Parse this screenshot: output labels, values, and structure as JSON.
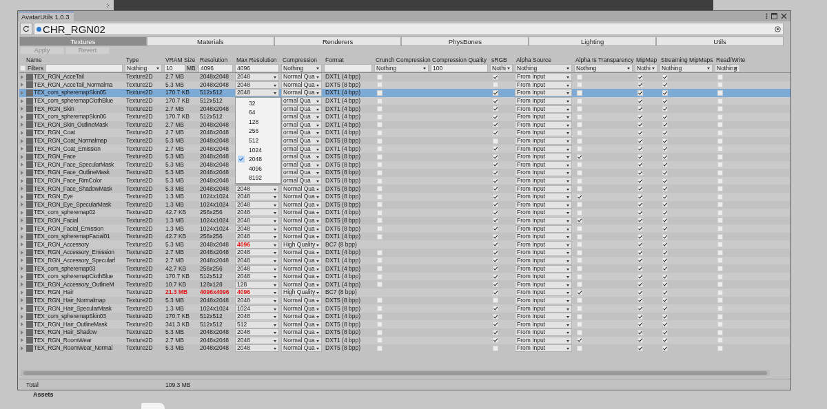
{
  "window": {
    "title": "AvatarUtils 1.0.3"
  },
  "object_field": {
    "value": "CHR_RGN02"
  },
  "tabs": [
    {
      "label": "Textures",
      "selected": true
    },
    {
      "label": "Materials",
      "selected": false
    },
    {
      "label": "Renderers",
      "selected": false
    },
    {
      "label": "PhysBones",
      "selected": false
    },
    {
      "label": "Lighting",
      "selected": false
    },
    {
      "label": "Utils",
      "selected": false
    }
  ],
  "actions": [
    {
      "label": "Apply",
      "disabled": true
    },
    {
      "label": "Revert",
      "disabled": true
    }
  ],
  "table": {
    "columns": [
      "Name",
      "Type",
      "VRAM Size",
      "Resolution",
      "Max Resolution",
      "Compression",
      "Format",
      "Crunch Compression",
      "Compression Quality",
      "sRGB",
      "Alpha Source",
      "Alpha Is Transparency",
      "MipMap",
      "Streaming MipMaps",
      "Read/Write"
    ],
    "filters": {
      "checked": false,
      "label": "Filters",
      "type": "Nothing",
      "vram": "10",
      "vram_unit": "MB",
      "resolution": "4096",
      "max_resolution": "4096",
      "compression": "Nothing",
      "crunch": "Nothing",
      "compression_quality": "100",
      "srgb": "Nothi",
      "alpha_source": "Nothing",
      "alpha_is_transparency": "Nothing",
      "mipmap": "Nothi",
      "streaming_mipmaps": "Nothing",
      "read_write": "Nothing"
    },
    "rows": [
      {
        "name": "TEX_RGN_AcceTail",
        "type": "Texture2D",
        "vram": "2.7 MB",
        "vram_warn": false,
        "resolution": "2048x2048",
        "resolution_warn": false,
        "max_resolution": "2048",
        "max_warn": false,
        "compression": "Normal Qua",
        "format": "DXT1 (4 bpp)",
        "crunch": false,
        "srgb": true,
        "alpha_source": "From Input",
        "alpha_is_transparency": false,
        "mipmap": true,
        "streaming_mipmaps": true,
        "read_write": false,
        "selected": false
      },
      {
        "name": "TEX_RGN_AcceTail_Normalma",
        "type": "Texture2D",
        "vram": "5.3 MB",
        "vram_warn": false,
        "resolution": "2048x2048",
        "resolution_warn": false,
        "max_resolution": "2048",
        "max_warn": false,
        "compression": "Normal Qua",
        "format": "DXT5 (8 bpp)",
        "crunch": false,
        "srgb": false,
        "alpha_source": "From Input",
        "alpha_is_transparency": false,
        "mipmap": true,
        "streaming_mipmaps": true,
        "read_write": false,
        "selected": false
      },
      {
        "name": "TEX_com_spheremapSkin05",
        "type": "Texture2D",
        "vram": "170.7 KB",
        "vram_warn": false,
        "resolution": "512x512",
        "resolution_warn": false,
        "max_resolution": "2048",
        "max_warn": false,
        "compression": "Normal Qua",
        "format": "DXT1 (4 bpp)",
        "crunch": false,
        "srgb": true,
        "alpha_source": "From Input",
        "alpha_is_transparency": false,
        "mipmap": true,
        "streaming_mipmaps": true,
        "read_write": false,
        "selected": true
      },
      {
        "name": "TEX_com_spheremapClothBlue",
        "type": "Texture2D",
        "vram": "170.7 KB",
        "vram_warn": false,
        "resolution": "512x512",
        "resolution_warn": false,
        "compression": "ormal Qua",
        "format": "DXT1 (4 bpp)",
        "crunch": false,
        "srgb": true,
        "alpha_source": "From Input",
        "alpha_is_transparency": false,
        "mipmap": true,
        "streaming_mipmaps": true,
        "read_write": false,
        "selected": false
      },
      {
        "name": "TEX_RGN_Skin",
        "type": "Texture2D",
        "vram": "2.7 MB",
        "vram_warn": false,
        "resolution": "2048x2048",
        "resolution_warn": false,
        "compression": "ormal Qua",
        "format": "DXT1 (4 bpp)",
        "crunch": false,
        "srgb": true,
        "alpha_source": "From Input",
        "alpha_is_transparency": false,
        "mipmap": true,
        "streaming_mipmaps": true,
        "read_write": false,
        "selected": false
      },
      {
        "name": "TEX_com_spheremapSkin06",
        "type": "Texture2D",
        "vram": "170.7 KB",
        "vram_warn": false,
        "resolution": "512x512",
        "resolution_warn": false,
        "compression": "ormal Qua",
        "format": "DXT1 (4 bpp)",
        "crunch": false,
        "srgb": true,
        "alpha_source": "From Input",
        "alpha_is_transparency": false,
        "mipmap": true,
        "streaming_mipmaps": true,
        "read_write": false,
        "selected": false
      },
      {
        "name": "TEX_RGN_Skin_OutlineMask",
        "type": "Texture2D",
        "vram": "2.7 MB",
        "vram_warn": false,
        "resolution": "2048x2048",
        "resolution_warn": false,
        "compression": "ormal Qua",
        "format": "DXT1 (4 bpp)",
        "crunch": false,
        "srgb": true,
        "alpha_source": "From Input",
        "alpha_is_transparency": false,
        "mipmap": true,
        "streaming_mipmaps": true,
        "read_write": false,
        "selected": false
      },
      {
        "name": "TEX_RGN_Coat",
        "type": "Texture2D",
        "vram": "2.7 MB",
        "vram_warn": false,
        "resolution": "2048x2048",
        "resolution_warn": false,
        "compression": "ormal Qua",
        "format": "DXT1 (4 bpp)",
        "crunch": false,
        "srgb": true,
        "alpha_source": "From Input",
        "alpha_is_transparency": false,
        "mipmap": true,
        "streaming_mipmaps": true,
        "read_write": false,
        "selected": false
      },
      {
        "name": "TEX_RGN_Coat_Normalmap",
        "type": "Texture2D",
        "vram": "5.3 MB",
        "vram_warn": false,
        "resolution": "2048x2048",
        "resolution_warn": false,
        "compression": "ormal Qua",
        "format": "DXT5 (8 bpp)",
        "crunch": false,
        "srgb": false,
        "alpha_source": "From Input",
        "alpha_is_transparency": false,
        "mipmap": true,
        "streaming_mipmaps": true,
        "read_write": false,
        "selected": false
      },
      {
        "name": "TEX_RGN_Coat_Emission",
        "type": "Texture2D",
        "vram": "2.7 MB",
        "vram_warn": false,
        "resolution": "2048x2048",
        "resolution_warn": false,
        "compression": "ormal Qua",
        "format": "DXT1 (4 bpp)",
        "crunch": false,
        "srgb": true,
        "alpha_source": "From Input",
        "alpha_is_transparency": false,
        "mipmap": true,
        "streaming_mipmaps": true,
        "read_write": false,
        "selected": false
      },
      {
        "name": "TEX_RGN_Face",
        "type": "Texture2D",
        "vram": "5.3 MB",
        "vram_warn": false,
        "resolution": "2048x2048",
        "resolution_warn": false,
        "compression": "ormal Qua",
        "format": "DXT5 (8 bpp)",
        "crunch": false,
        "srgb": true,
        "alpha_source": "From Input",
        "alpha_is_transparency": true,
        "mipmap": true,
        "streaming_mipmaps": true,
        "read_write": false,
        "selected": false
      },
      {
        "name": "TEX_RGN_Face_SpecularMask",
        "type": "Texture2D",
        "vram": "5.3 MB",
        "vram_warn": false,
        "resolution": "2048x2048",
        "resolution_warn": false,
        "compression": "ormal Qua",
        "format": "DXT5 (8 bpp)",
        "crunch": false,
        "srgb": true,
        "alpha_source": "From Input",
        "alpha_is_transparency": false,
        "mipmap": true,
        "streaming_mipmaps": true,
        "read_write": false,
        "selected": false
      },
      {
        "name": "TEX_RGN_Face_OutlineMask",
        "type": "Texture2D",
        "vram": "5.3 MB",
        "vram_warn": false,
        "resolution": "2048x2048",
        "resolution_warn": false,
        "compression": "ormal Qua",
        "format": "DXT5 (8 bpp)",
        "crunch": false,
        "srgb": true,
        "alpha_source": "From Input",
        "alpha_is_transparency": false,
        "mipmap": true,
        "streaming_mipmaps": true,
        "read_write": false,
        "selected": false
      },
      {
        "name": "TEX_RGN_Face_RimColor",
        "type": "Texture2D",
        "vram": "5.3 MB",
        "vram_warn": false,
        "resolution": "2048x2048",
        "resolution_warn": false,
        "compression": "ormal Qua",
        "format": "DXT5 (8 bpp)",
        "crunch": false,
        "srgb": true,
        "alpha_source": "From Input",
        "alpha_is_transparency": false,
        "mipmap": true,
        "streaming_mipmaps": true,
        "read_write": false,
        "selected": false
      },
      {
        "name": "TEX_RGN_Face_ShadowMask",
        "type": "Texture2D",
        "vram": "5.3 MB",
        "vram_warn": false,
        "resolution": "2048x2048",
        "resolution_warn": false,
        "max_resolution": "2048",
        "max_warn": false,
        "compression": "Normal Qua",
        "format": "DXT5 (8 bpp)",
        "crunch": false,
        "srgb": true,
        "alpha_source": "From Input",
        "alpha_is_transparency": false,
        "mipmap": true,
        "streaming_mipmaps": true,
        "read_write": false,
        "selected": false
      },
      {
        "name": "TEX_RGN_Eye",
        "type": "Texture2D",
        "vram": "1.3 MB",
        "vram_warn": false,
        "resolution": "1024x1024",
        "resolution_warn": false,
        "max_resolution": "2048",
        "max_warn": false,
        "compression": "Normal Qua",
        "format": "DXT5 (8 bpp)",
        "crunch": false,
        "srgb": true,
        "alpha_source": "From Input",
        "alpha_is_transparency": true,
        "mipmap": true,
        "streaming_mipmaps": true,
        "read_write": false,
        "selected": false
      },
      {
        "name": "TEX_RGN_Eye_SpecularMask",
        "type": "Texture2D",
        "vram": "1.3 MB",
        "vram_warn": false,
        "resolution": "1024x1024",
        "resolution_warn": false,
        "max_resolution": "2048",
        "max_warn": false,
        "compression": "Normal Qua",
        "format": "DXT5 (8 bpp)",
        "crunch": false,
        "srgb": true,
        "alpha_source": "From Input",
        "alpha_is_transparency": false,
        "mipmap": true,
        "streaming_mipmaps": true,
        "read_write": false,
        "selected": false
      },
      {
        "name": "TEX_com_spheremap02",
        "type": "Texture2D",
        "vram": "42.7 KB",
        "vram_warn": false,
        "resolution": "256x256",
        "resolution_warn": false,
        "max_resolution": "2048",
        "max_warn": false,
        "compression": "Normal Qua",
        "format": "DXT1 (4 bpp)",
        "crunch": false,
        "srgb": true,
        "alpha_source": "From Input",
        "alpha_is_transparency": false,
        "mipmap": true,
        "streaming_mipmaps": true,
        "read_write": false,
        "selected": false
      },
      {
        "name": "TEX_RGN_Facial",
        "type": "Texture2D",
        "vram": "1.3 MB",
        "vram_warn": false,
        "resolution": "1024x1024",
        "resolution_warn": false,
        "max_resolution": "2048",
        "max_warn": false,
        "compression": "Normal Qua",
        "format": "DXT5 (8 bpp)",
        "crunch": false,
        "srgb": true,
        "alpha_source": "From Input",
        "alpha_is_transparency": true,
        "mipmap": true,
        "streaming_mipmaps": true,
        "read_write": false,
        "selected": false
      },
      {
        "name": "TEX_RGN_Facial_Emission",
        "type": "Texture2D",
        "vram": "1.3 MB",
        "vram_warn": false,
        "resolution": "1024x1024",
        "resolution_warn": false,
        "max_resolution": "2048",
        "max_warn": false,
        "compression": "Normal Qua",
        "format": "DXT5 (8 bpp)",
        "crunch": false,
        "srgb": true,
        "alpha_source": "From Input",
        "alpha_is_transparency": false,
        "mipmap": true,
        "streaming_mipmaps": true,
        "read_write": false,
        "selected": false
      },
      {
        "name": "TEX_com_spheremapFacial01",
        "type": "Texture2D",
        "vram": "42.7 KB",
        "vram_warn": false,
        "resolution": "256x256",
        "resolution_warn": false,
        "max_resolution": "2048",
        "max_warn": false,
        "compression": "Normal Qua",
        "format": "DXT1 (4 bpp)",
        "crunch": false,
        "srgb": true,
        "alpha_source": "From Input",
        "alpha_is_transparency": false,
        "mipmap": true,
        "streaming_mipmaps": true,
        "read_write": false,
        "selected": false
      },
      {
        "name": "TEX_RGN_Accessory",
        "type": "Texture2D",
        "vram": "5.3 MB",
        "vram_warn": false,
        "resolution": "2048x2048",
        "resolution_warn": false,
        "max_resolution": "4096",
        "max_warn": true,
        "compression": "High Quality",
        "format": "BC7 (8 bpp)",
        "srgb": true,
        "alpha_source": "From Input",
        "alpha_is_transparency": false,
        "mipmap": true,
        "streaming_mipmaps": true,
        "read_write": false,
        "selected": false
      },
      {
        "name": "TEX_RGN_Accessory_Emission",
        "type": "Texture2D",
        "vram": "2.7 MB",
        "vram_warn": false,
        "resolution": "2048x2048",
        "resolution_warn": false,
        "max_resolution": "2048",
        "max_warn": false,
        "compression": "Normal Qua",
        "format": "DXT1 (4 bpp)",
        "crunch": false,
        "srgb": true,
        "alpha_source": "From Input",
        "alpha_is_transparency": false,
        "mipmap": true,
        "streaming_mipmaps": true,
        "read_write": false,
        "selected": false
      },
      {
        "name": "TEX_RGN_Accessory_Specularf",
        "type": "Texture2D",
        "vram": "2.7 MB",
        "vram_warn": false,
        "resolution": "2048x2048",
        "resolution_warn": false,
        "max_resolution": "2048",
        "max_warn": false,
        "compression": "Normal Qua",
        "format": "DXT1 (4 bpp)",
        "crunch": false,
        "srgb": true,
        "alpha_source": "From Input",
        "alpha_is_transparency": false,
        "mipmap": true,
        "streaming_mipmaps": true,
        "read_write": false,
        "selected": false
      },
      {
        "name": "TEX_com_spheremap03",
        "type": "Texture2D",
        "vram": "42.7 KB",
        "vram_warn": false,
        "resolution": "256x256",
        "resolution_warn": false,
        "max_resolution": "2048",
        "max_warn": false,
        "compression": "Normal Qua",
        "format": "DXT1 (4 bpp)",
        "crunch": false,
        "srgb": true,
        "alpha_source": "From Input",
        "alpha_is_transparency": false,
        "mipmap": true,
        "streaming_mipmaps": true,
        "read_write": false,
        "selected": false
      },
      {
        "name": "TEX_com_spheremapClothBlue",
        "type": "Texture2D",
        "vram": "170.7 KB",
        "vram_warn": false,
        "resolution": "512x512",
        "resolution_warn": false,
        "max_resolution": "2048",
        "max_warn": false,
        "compression": "Normal Qua",
        "format": "DXT1 (4 bpp)",
        "crunch": false,
        "srgb": true,
        "alpha_source": "From Input",
        "alpha_is_transparency": false,
        "mipmap": true,
        "streaming_mipmaps": true,
        "read_write": false,
        "selected": false
      },
      {
        "name": "TEX_RGN_Accessory_OutlineM",
        "type": "Texture2D",
        "vram": "10.7 KB",
        "vram_warn": false,
        "resolution": "128x128",
        "resolution_warn": false,
        "max_resolution": "128",
        "max_warn": false,
        "compression": "Normal Qua",
        "format": "DXT1 (4 bpp)",
        "crunch": false,
        "srgb": true,
        "alpha_source": "From Input",
        "alpha_is_transparency": false,
        "mipmap": true,
        "streaming_mipmaps": true,
        "read_write": false,
        "selected": false
      },
      {
        "name": "TEX_RGN_Hair",
        "type": "Texture2D",
        "vram": "21.3 MB",
        "vram_warn": true,
        "resolution": "4096x4096",
        "resolution_warn": true,
        "max_resolution": "4096",
        "max_warn": true,
        "compression": "High Quality",
        "format": "BC7 (8 bpp)",
        "srgb": true,
        "alpha_source": "From Input",
        "alpha_is_transparency": true,
        "mipmap": true,
        "streaming_mipmaps": true,
        "read_write": false,
        "selected": false
      },
      {
        "name": "TEX_RGN_Hair_Normalmap",
        "type": "Texture2D",
        "vram": "5.3 MB",
        "vram_warn": false,
        "resolution": "2048x2048",
        "resolution_warn": false,
        "max_resolution": "2048",
        "max_warn": false,
        "compression": "Normal Qua",
        "format": "DXT5 (8 bpp)",
        "crunch": false,
        "srgb": false,
        "alpha_source": "From Input",
        "alpha_is_transparency": false,
        "mipmap": true,
        "streaming_mipmaps": true,
        "read_write": false,
        "selected": false
      },
      {
        "name": "TEX_RGN_Hair_SpecularMask",
        "type": "Texture2D",
        "vram": "1.3 MB",
        "vram_warn": false,
        "resolution": "1024x1024",
        "resolution_warn": false,
        "max_resolution": "1024",
        "max_warn": false,
        "compression": "Normal Qua",
        "format": "DXT5 (8 bpp)",
        "crunch": false,
        "srgb": true,
        "alpha_source": "From Input",
        "alpha_is_transparency": false,
        "mipmap": true,
        "streaming_mipmaps": true,
        "read_write": false,
        "selected": false
      },
      {
        "name": "TEX_com_spheremapSkin03",
        "type": "Texture2D",
        "vram": "170.7 KB",
        "vram_warn": false,
        "resolution": "512x512",
        "resolution_warn": false,
        "max_resolution": "2048",
        "max_warn": false,
        "compression": "Normal Qua",
        "format": "DXT1 (4 bpp)",
        "crunch": false,
        "srgb": true,
        "alpha_source": "From Input",
        "alpha_is_transparency": false,
        "mipmap": true,
        "streaming_mipmaps": true,
        "read_write": false,
        "selected": false
      },
      {
        "name": "TEX_RGN_Hair_OutlineMask",
        "type": "Texture2D",
        "vram": "341.3 KB",
        "vram_warn": false,
        "resolution": "512x512",
        "resolution_warn": false,
        "max_resolution": "512",
        "max_warn": false,
        "compression": "Normal Qua",
        "format": "DXT5 (8 bpp)",
        "crunch": false,
        "srgb": true,
        "alpha_source": "From Input",
        "alpha_is_transparency": false,
        "mipmap": true,
        "streaming_mipmaps": true,
        "read_write": false,
        "selected": false
      },
      {
        "name": "TEX_RGN_Hair_Shadow",
        "type": "Texture2D",
        "vram": "5.3 MB",
        "vram_warn": false,
        "resolution": "2048x2048",
        "resolution_warn": false,
        "max_resolution": "2048",
        "max_warn": false,
        "compression": "Normal Qua",
        "format": "DXT5 (8 bpp)",
        "crunch": false,
        "srgb": true,
        "alpha_source": "From Input",
        "alpha_is_transparency": false,
        "mipmap": true,
        "streaming_mipmaps": true,
        "read_write": false,
        "selected": false
      },
      {
        "name": "TEX_RGN_RoomWear",
        "type": "Texture2D",
        "vram": "2.7 MB",
        "vram_warn": false,
        "resolution": "2048x2048",
        "resolution_warn": false,
        "max_resolution": "2048",
        "max_warn": false,
        "compression": "Normal Qua",
        "format": "DXT1 (4 bpp)",
        "crunch": false,
        "srgb": true,
        "alpha_source": "From Input",
        "alpha_is_transparency": true,
        "mipmap": true,
        "streaming_mipmaps": true,
        "read_write": false,
        "selected": false
      },
      {
        "name": "TEX_RGN_RoomWear_Normal",
        "type": "Texture2D",
        "vram": "5.3 MB",
        "vram_warn": false,
        "resolution": "2048x2048",
        "resolution_warn": false,
        "max_resolution": "2048",
        "max_warn": false,
        "compression": "Normal Qua",
        "format": "DXT5 (8 bpp)",
        "crunch": false,
        "srgb": false,
        "alpha_source": "From Input",
        "alpha_is_transparency": false,
        "mipmap": true,
        "streaming_mipmaps": true,
        "read_write": false,
        "selected": false
      }
    ],
    "total": {
      "label": "Total",
      "vram": "109.3 MB"
    }
  },
  "max_resolution_menu": {
    "options": [
      {
        "label": "32",
        "selected": false
      },
      {
        "label": "64",
        "selected": false
      },
      {
        "label": "128",
        "selected": false
      },
      {
        "label": "256",
        "selected": false
      },
      {
        "label": "512",
        "selected": false
      },
      {
        "label": "1024",
        "selected": false
      },
      {
        "label": "2048",
        "selected": true
      },
      {
        "label": "4096",
        "selected": false
      },
      {
        "label": "8192",
        "selected": false
      }
    ]
  },
  "background": {
    "panel_label": "Assets"
  }
}
